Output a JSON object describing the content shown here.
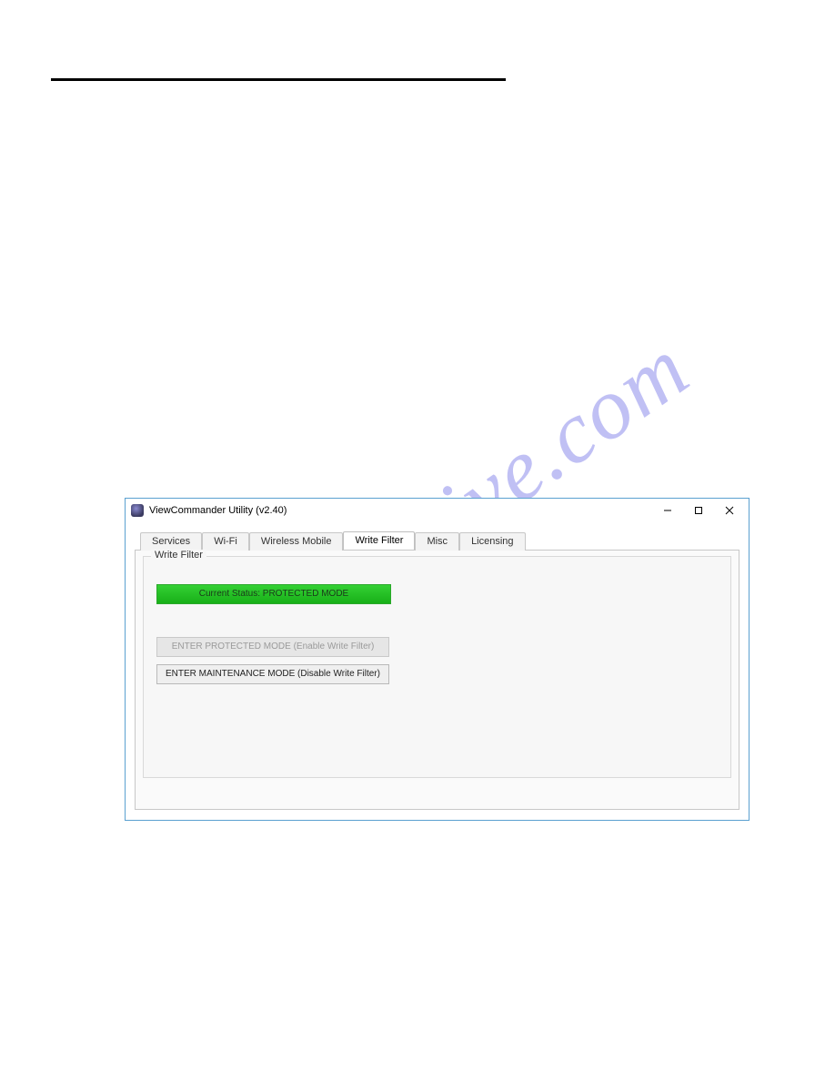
{
  "watermark": "manualshive.com",
  "window": {
    "title": "ViewCommander Utility (v2.40)",
    "tabs": [
      {
        "label": "Services"
      },
      {
        "label": "Wi-Fi"
      },
      {
        "label": "Wireless Mobile"
      },
      {
        "label": "Write Filter"
      },
      {
        "label": "Misc"
      },
      {
        "label": "Licensing"
      }
    ],
    "active_tab_index": 3,
    "group_label": "Write Filter",
    "status_text": "Current Status: PROTECTED MODE",
    "enter_protected_label": "ENTER PROTECTED MODE (Enable Write Filter)",
    "enter_maintenance_label": "ENTER MAINTENANCE MODE (Disable Write Filter)"
  }
}
